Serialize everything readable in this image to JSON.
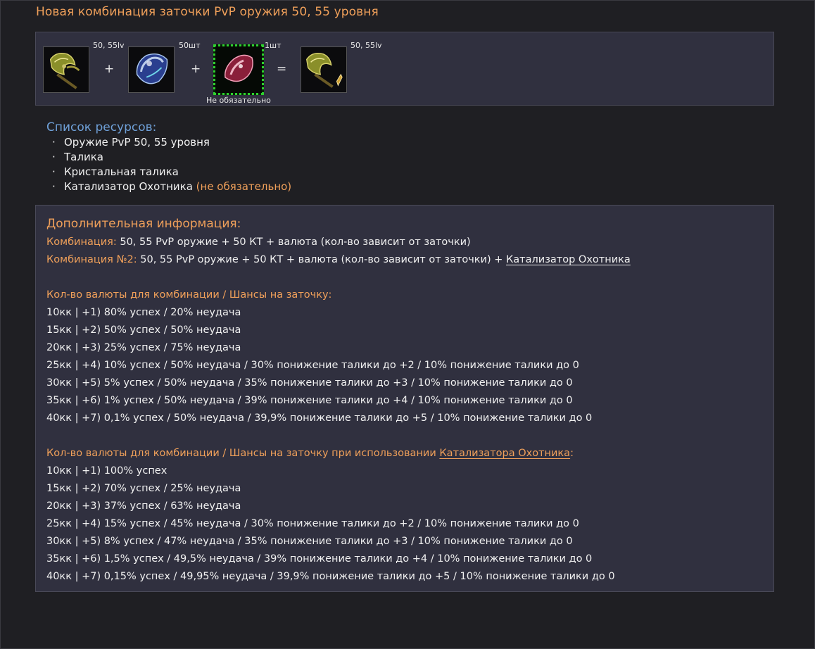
{
  "page_title": "Новая комбинация заточки PvP оружия 50, 55 уровня",
  "combination": {
    "slots": [
      {
        "item": "pvp-weapon",
        "qty": "50, 55lv"
      },
      {
        "item": "talika",
        "qty": "50шт"
      },
      {
        "item": "crystal-talika",
        "qty": "1шт"
      },
      {
        "item": "result-weapon",
        "qty": "50, 55lv"
      }
    ],
    "operators": [
      "+",
      "+",
      "="
    ],
    "optional_label": "Не обязательно",
    "optional_color": "#2ed12e"
  },
  "resources": {
    "title": "Список ресурсов:",
    "bullet": "·",
    "items": [
      {
        "text": "Оружие PvP 50, 55 уровня",
        "note": ""
      },
      {
        "text": "Талика",
        "note": ""
      },
      {
        "text": "Кристальная талика",
        "note": ""
      },
      {
        "text": "Катализатор Охотника ",
        "note": "(не обязательно)"
      }
    ]
  },
  "info": {
    "title": "Дополнительная информация:",
    "combo1_label": "Комбинация:",
    "combo1_text": " 50, 55 PvP оружие + 50 КТ  + валюта (кол-во зависит от заточки)",
    "combo2_label": "Комбинация №2:",
    "combo2_text": " 50, 55 PvP оружие + 50 КТ + валюта (кол-во зависит от заточки) + ",
    "combo2_link": "Катализатор Охотника",
    "table1_header": "Кол-во валюты для комбинации / Шансы на заточку:",
    "table1_rows": [
      "10кк | +1) 80% успех / 20% неудача",
      "15кк | +2) 50% успех / 50% неудача",
      "20кк | +3) 25% успех / 75% неудача",
      "25кк | +4) 10% успех / 50% неудача / 30% понижение талики до +2 / 10% понижение талики до 0",
      "30кк | +5) 5% успех / 50% неудача / 35% понижение талики до +3 / 10% понижение талики до 0",
      "35кк | +6) 1% успех / 50% неудача / 39% понижение талики до +4 / 10% понижение талики до 0",
      "40кк | +7) 0,1% успех / 50% неудача / 39,9% понижение талики до +5 / 10% понижение талики до 0"
    ],
    "table2_header": "Кол-во валюты для комбинации / Шансы на заточку при использовании ",
    "table2_link": "Катализатора Охотника",
    "table2_colon": ":",
    "table2_rows": [
      "10кк | +1) 100% успех",
      "15кк | +2) 70% успех / 25% неудача",
      "20кк | +3) 37% успех / 63% неудача",
      "25кк | +4) 15% успех / 45% неудача / 30% понижение талики до +2 / 10% понижение талики до 0",
      "30кк | +5) 8% успех / 47% неудача / 35% понижение талики до +3 / 10% понижение талики до 0",
      "35кк | +6) 1,5% успех / 49,5% неудача / 39% понижение талики до +4 / 10% понижение талики до 0",
      "40кк | +7) 0,15% успех / 49,95% неудача / 39,9% понижение талики до +5 / 10% понижение талики до 0"
    ]
  },
  "colors": {
    "accent": "#f0a05a",
    "heading_blue": "#6fa0d8",
    "panel": "#30303f",
    "background": "#1f1f23"
  }
}
